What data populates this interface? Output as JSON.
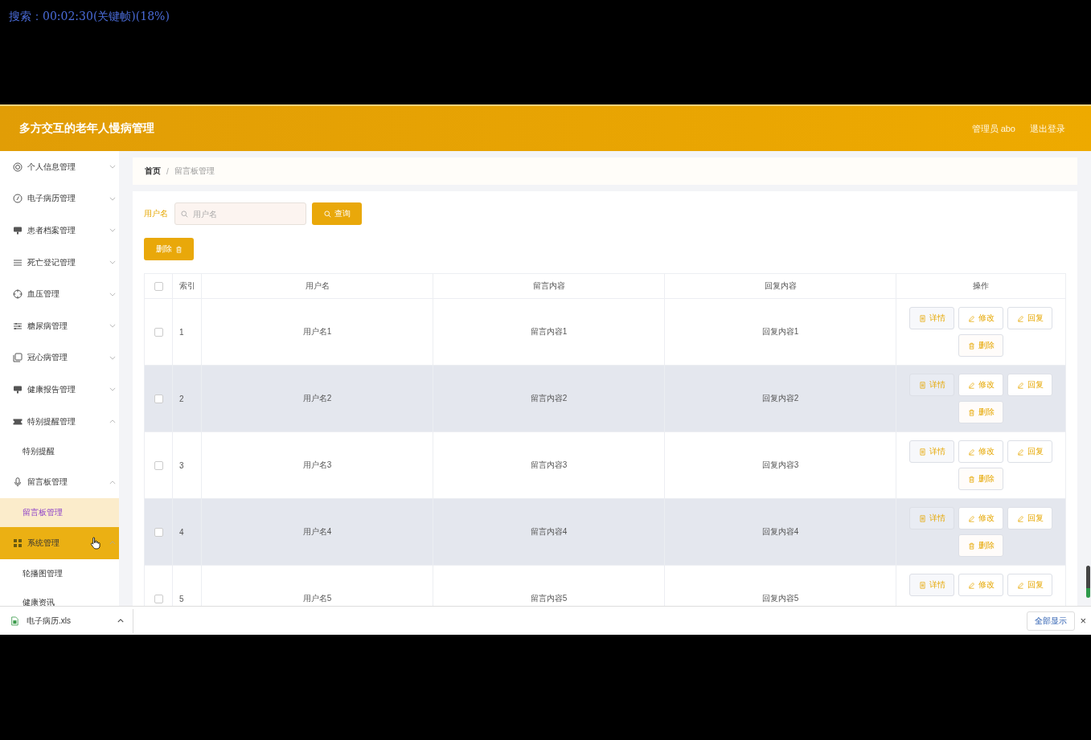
{
  "overlay": {
    "text": "搜索：00:02:30(关键帧)(18%)"
  },
  "header": {
    "title": "多方交互的老年人慢病管理",
    "user": "管理员 abo",
    "logout": "退出登录"
  },
  "sidebar": {
    "items": [
      {
        "label": "个人信息管理",
        "expanded": false,
        "hovered": false,
        "selected": false
      },
      {
        "label": "电子病历管理",
        "expanded": false,
        "hovered": false,
        "selected": false
      },
      {
        "label": "患者档案管理",
        "expanded": false,
        "hovered": false,
        "selected": false
      },
      {
        "label": "死亡登记管理",
        "expanded": false,
        "hovered": false,
        "selected": false
      },
      {
        "label": "血压管理",
        "expanded": false,
        "hovered": false,
        "selected": false
      },
      {
        "label": "糖尿病管理",
        "expanded": false,
        "hovered": false,
        "selected": false
      },
      {
        "label": "冠心病管理",
        "expanded": false,
        "hovered": false,
        "selected": false
      },
      {
        "label": "健康报告管理",
        "expanded": false,
        "hovered": false,
        "selected": false
      },
      {
        "label": "特别提醒管理",
        "expanded": true,
        "hovered": false,
        "selected": false,
        "children": [
          {
            "label": "特别提醒",
            "selected": false
          }
        ]
      },
      {
        "label": "留言板管理",
        "expanded": true,
        "hovered": false,
        "selected": false,
        "children": [
          {
            "label": "留言板管理",
            "selected": true
          }
        ]
      },
      {
        "label": "系统管理",
        "expanded": true,
        "hovered": true,
        "selected": false,
        "children": [
          {
            "label": "轮播图管理",
            "selected": false
          },
          {
            "label": "健康资讯",
            "selected": false
          }
        ]
      }
    ]
  },
  "breadcrumb": {
    "separator": "/",
    "items": [
      {
        "label": "首页",
        "current": false
      },
      {
        "label": "留言板管理",
        "current": true
      }
    ]
  },
  "search": {
    "label": "用户名",
    "placeholder": "用户名",
    "button": "查询"
  },
  "delete_button": "删除",
  "table": {
    "header_checked": false,
    "columns": [
      "索引",
      "用户名",
      "留言内容",
      "回复内容",
      "操作"
    ],
    "rows": [
      {
        "checked": false,
        "striped": false,
        "cells": [
          "1",
          "用户名1",
          "留言内容1",
          "回复内容1"
        ],
        "actions": [
          {
            "kind": "detail",
            "label": "详情"
          },
          {
            "kind": "edit",
            "label": "修改"
          },
          {
            "kind": "reply",
            "label": "回复"
          },
          {
            "kind": "delete",
            "label": "删除"
          }
        ]
      },
      {
        "checked": false,
        "striped": true,
        "cells": [
          "2",
          "用户名2",
          "留言内容2",
          "回复内容2"
        ],
        "actions": [
          {
            "kind": "detail",
            "label": "详情"
          },
          {
            "kind": "edit",
            "label": "修改"
          },
          {
            "kind": "reply",
            "label": "回复"
          },
          {
            "kind": "delete",
            "label": "删除"
          }
        ]
      },
      {
        "checked": false,
        "striped": false,
        "cells": [
          "3",
          "用户名3",
          "留言内容3",
          "回复内容3"
        ],
        "actions": [
          {
            "kind": "detail",
            "label": "详情"
          },
          {
            "kind": "edit",
            "label": "修改"
          },
          {
            "kind": "reply",
            "label": "回复"
          },
          {
            "kind": "delete",
            "label": "删除"
          }
        ]
      },
      {
        "checked": false,
        "striped": true,
        "cells": [
          "4",
          "用户名4",
          "留言内容4",
          "回复内容4"
        ],
        "actions": [
          {
            "kind": "detail",
            "label": "详情"
          },
          {
            "kind": "edit",
            "label": "修改"
          },
          {
            "kind": "reply",
            "label": "回复"
          },
          {
            "kind": "delete",
            "label": "删除"
          }
        ]
      },
      {
        "checked": false,
        "striped": false,
        "cells": [
          "5",
          "用户名5",
          "留言内容5",
          "回复内容5"
        ],
        "actions": [
          {
            "kind": "detail",
            "label": "详情"
          },
          {
            "kind": "edit",
            "label": "修改"
          },
          {
            "kind": "reply",
            "label": "回复"
          }
        ]
      }
    ]
  },
  "downloads": {
    "file": "电子病历.xls",
    "show_all": "全部显示",
    "close": "×"
  }
}
